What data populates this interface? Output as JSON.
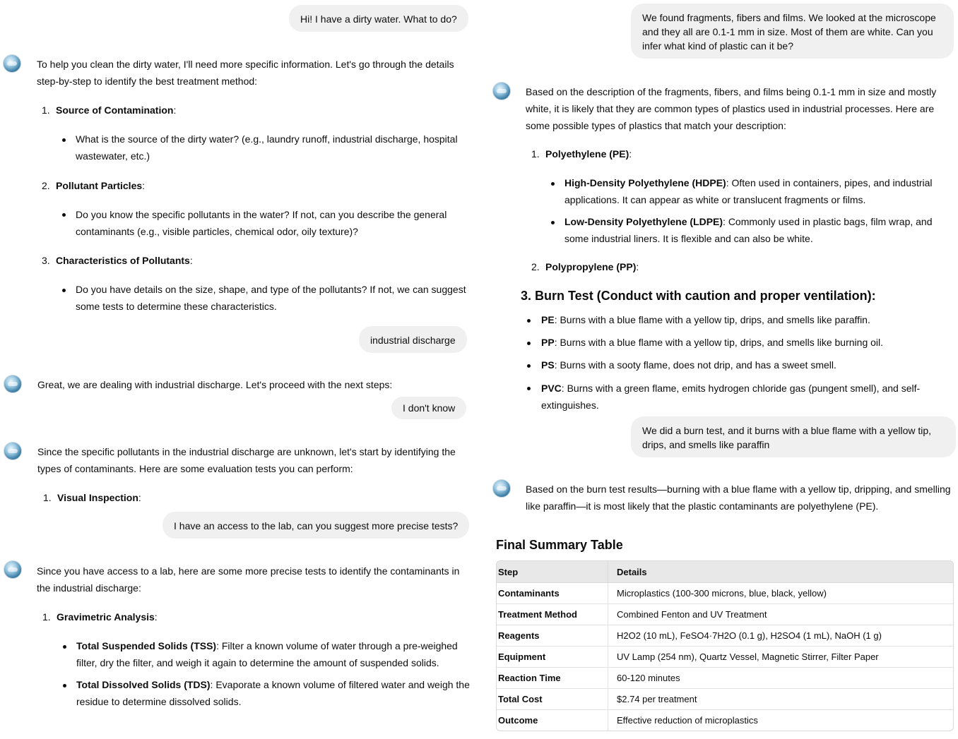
{
  "left": {
    "u1": "Hi! I have a dirty water. What to do?",
    "a1": {
      "intro": "To help you clean the dirty water, I'll need more specific information. Let's go through the details step-by-step to identify the best treatment method:",
      "items": [
        {
          "num": "1.",
          "title": "Source of Contamination",
          "bullet": "What is the source of the dirty water? (e.g., laundry runoff, industrial discharge, hospital wastewater, etc.)"
        },
        {
          "num": "2.",
          "title": "Pollutant Particles",
          "bullet": "Do you know the specific pollutants in the water? If not, can you describe the general contaminants (e.g., visible particles, chemical odor, oily texture)?"
        },
        {
          "num": "3.",
          "title": "Characteristics of Pollutants",
          "bullet": "Do you have details on the size, shape, and type of the pollutants? If not, we can suggest some tests to determine these characteristics."
        }
      ]
    },
    "u2": "industrial discharge",
    "a2": "Great, we are dealing with industrial discharge. Let's proceed with the next steps:",
    "u3": "I don't know",
    "a3": {
      "intro": "Since the specific pollutants in the industrial discharge are unknown, let's start by identifying the types of contaminants. Here are some evaluation tests you can perform:",
      "num": "1.",
      "title": "Visual Inspection"
    },
    "u4": "I have an access to the lab, can you suggest more precise tests?",
    "a4": {
      "intro": "Since you have access to a lab, here are some more precise tests to identify the contaminants in the industrial discharge:",
      "num": "1.",
      "title": "Gravimetric Analysis",
      "bullets": [
        {
          "bold": "Total Suspended Solids (TSS)",
          "text": ": Filter a known volume of water through a pre-weighed filter, dry the filter, and weigh it again to determine the amount of suspended solids."
        },
        {
          "bold": "Total Dissolved Solids (TDS)",
          "text": ": Evaporate a known volume of filtered water and weigh the residue to determine dissolved solids."
        }
      ]
    }
  },
  "right": {
    "u1": "We found fragments, fibers and films. We looked at the microscope and they all are 0.1-1 mm in size. Most of them are white. Can you infer what kind of plastic can it be?",
    "a1": {
      "intro": "Based on the description of the fragments, fibers, and films being 0.1-1 mm in size and mostly white, it is likely that they are common types of plastics used in industrial processes. Here are some possible types of plastics that match your description:",
      "item1_num": "1.",
      "item1_title": "Polyethylene (PE)",
      "bullets": [
        {
          "bold": "High-Density Polyethylene (HDPE)",
          "text": ": Often used in containers, pipes, and industrial applications. It can appear as white or translucent fragments or films."
        },
        {
          "bold": "Low-Density Polyethylene (LDPE)",
          "text": ": Commonly used in plastic bags, film wrap, and some industrial liners. It is flexible and can also be white."
        }
      ],
      "item2_num": "2.",
      "item2_title": "Polypropylene (PP)",
      "burn_heading": "3. Burn Test (Conduct with caution and proper ventilation):",
      "burn": [
        {
          "bold": "PE",
          "text": ": Burns with a blue flame with a yellow tip, drips, and smells like paraffin."
        },
        {
          "bold": "PP",
          "text": ": Burns with a blue flame with a yellow tip, drips, and smells like burning oil."
        },
        {
          "bold": "PS",
          "text": ": Burns with a sooty flame, does not drip, and has a sweet smell."
        },
        {
          "bold": "PVC",
          "text": ": Burns with a green flame, emits hydrogen chloride gas (pungent smell), and self-extinguishes."
        }
      ]
    },
    "u2": "We did a burn test, and it burns with a blue flame with a yellow tip, drips, and smells like paraffin",
    "a2": "Based on the burn test results—burning with a blue flame with a yellow tip, dripping, and smelling like paraffin—it is most likely that the plastic contaminants are polyethylene (PE).",
    "summary_title": "Final Summary Table",
    "table": {
      "headers": [
        "Step",
        "Details"
      ],
      "rows": [
        [
          "Contaminants",
          "Microplastics (100-300 microns, blue, black, yellow)"
        ],
        [
          "Treatment Method",
          "Combined Fenton and UV Treatment"
        ],
        [
          "Reagents",
          "H2O2 (10 mL), FeSO4·7H2O (0.1 g), H2SO4 (1 mL), NaOH (1 g)"
        ],
        [
          "Equipment",
          "UV Lamp (254 nm), Quartz Vessel, Magnetic Stirrer, Filter Paper"
        ],
        [
          "Reaction Time",
          "60-120 minutes"
        ],
        [
          "Total Cost",
          "$2.74 per treatment"
        ],
        [
          "Outcome",
          "Effective reduction of microplastics"
        ]
      ]
    }
  }
}
